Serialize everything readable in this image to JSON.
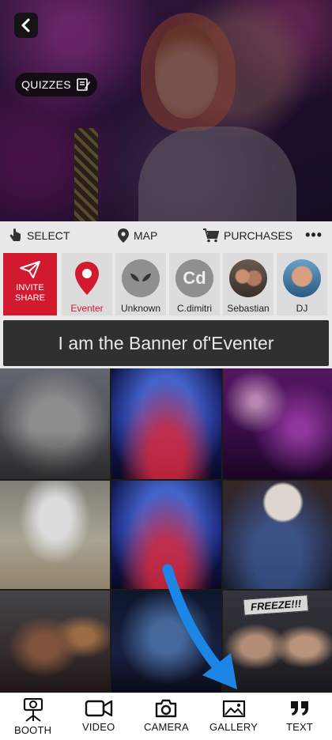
{
  "hero": {
    "quiz_label": "QUIZZES"
  },
  "actions": {
    "select": "SELECT",
    "map": "MAP",
    "purchases": "PURCHASES",
    "more": "•••"
  },
  "invite": {
    "line1": "INVITE",
    "line2": "SHARE"
  },
  "people": [
    {
      "name": "Eventer",
      "avatar": "location-pin-icon",
      "active": true
    },
    {
      "name": "Unknown",
      "avatar": "alien-icon"
    },
    {
      "name": "C.dimitri",
      "avatar": "Cd"
    },
    {
      "name": "Sebastian",
      "avatar": "photo"
    },
    {
      "name": "DJ",
      "avatar": "photo"
    }
  ],
  "banner": {
    "text": "I am the Banner of'Eventer"
  },
  "gallery": {
    "freeze_label": "FREEZE!!!"
  },
  "nav": {
    "booth": "BOOTH",
    "video": "VIDEO",
    "camera": "CAMERA",
    "gallery": "GALLERY",
    "text": "TEXT"
  },
  "colors": {
    "accent_red": "#d3192e",
    "hint_blue": "#1c86e6",
    "banner_bg": "#303030"
  }
}
